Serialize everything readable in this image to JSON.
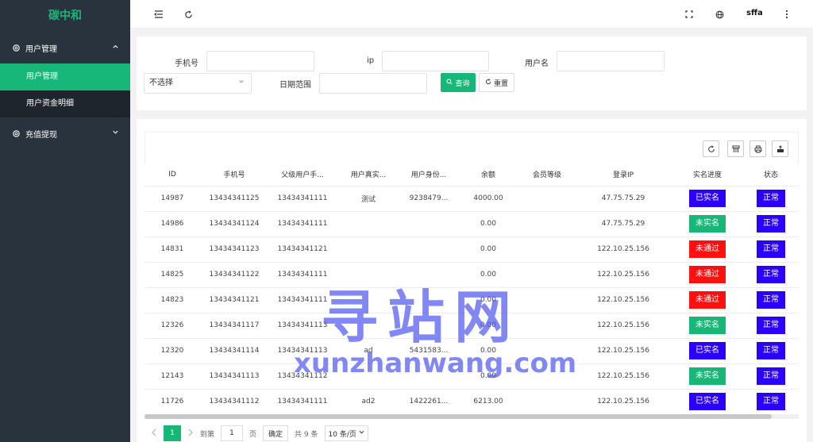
{
  "sidebar": {
    "logo": "碳中和",
    "groups": [
      {
        "label": "用户管理",
        "items": [
          {
            "label": "用户管理"
          },
          {
            "label": "用户资金明细"
          }
        ]
      },
      {
        "label": "充值提现"
      }
    ]
  },
  "topbar": {
    "username": "sffa"
  },
  "search": {
    "phone_label": "手机号",
    "ip_label": "ip",
    "username_label": "用户名",
    "select_value": "不选择",
    "date_label": "日期范围",
    "query_label": "查询",
    "reset_label": "重置"
  },
  "table": {
    "columns": [
      "ID",
      "手机号",
      "父级用户手...",
      "用户真实...",
      "用户身份...",
      "余额",
      "会员等级",
      "登录IP",
      "实名进度",
      "状态"
    ],
    "rows": [
      {
        "id": "14987",
        "phone": "13434341125",
        "parent": "13434341111",
        "realname": "测试",
        "idcard": "9238479...",
        "balance": "4000.00",
        "level": "",
        "ip": "47.75.75.29",
        "verify": "已实名",
        "status": "正常"
      },
      {
        "id": "14986",
        "phone": "13434341124",
        "parent": "13434341111",
        "realname": "",
        "idcard": "",
        "balance": "0.00",
        "level": "",
        "ip": "47.75.75.29",
        "verify": "未实名",
        "status": "正常"
      },
      {
        "id": "14831",
        "phone": "13434341123",
        "parent": "13434341121",
        "realname": "",
        "idcard": "",
        "balance": "0.00",
        "level": "",
        "ip": "122.10.25.156",
        "verify": "未通过",
        "status": "正常"
      },
      {
        "id": "14825",
        "phone": "13434341122",
        "parent": "13434341111",
        "realname": "",
        "idcard": "",
        "balance": "0.00",
        "level": "",
        "ip": "122.10.25.156",
        "verify": "未通过",
        "status": "正常"
      },
      {
        "id": "14823",
        "phone": "13434341121",
        "parent": "13434341111",
        "realname": "",
        "idcard": "",
        "balance": "0.00",
        "level": "",
        "ip": "122.10.25.156",
        "verify": "未通过",
        "status": "正常"
      },
      {
        "id": "12326",
        "phone": "13434341117",
        "parent": "13434341113",
        "realname": "",
        "idcard": "",
        "balance": "0.00",
        "level": "",
        "ip": "122.10.25.156",
        "verify": "未实名",
        "status": "正常"
      },
      {
        "id": "12320",
        "phone": "13434341114",
        "parent": "13434341113",
        "realname": "ad",
        "idcard": "5431583...",
        "balance": "0.00",
        "level": "",
        "ip": "122.10.25.156",
        "verify": "已实名",
        "status": "正常"
      },
      {
        "id": "12143",
        "phone": "13434341113",
        "parent": "13434341112",
        "realname": "",
        "idcard": "",
        "balance": "0.00",
        "level": "",
        "ip": "122.10.25.156",
        "verify": "未实名",
        "status": "正常"
      },
      {
        "id": "11726",
        "phone": "13434341112",
        "parent": "13434341111",
        "realname": "ad2",
        "idcard": "1422261...",
        "balance": "6213.00",
        "level": "",
        "ip": "122.10.25.156",
        "verify": "已实名",
        "status": "正常"
      }
    ]
  },
  "pager": {
    "current": "1",
    "goto_label": "到第",
    "goto_value": "1",
    "page_unit": "页",
    "confirm_label": "确定",
    "total_label": "共 9 条",
    "page_size": "10 条/页"
  },
  "watermark": {
    "cn": "寻站网",
    "en": "xunzhanwang.com"
  },
  "colors": {
    "brand": "#16b777",
    "sidebar_bg": "#28333e",
    "verified": "#2b00ff",
    "unverified": "#16b777",
    "rejected": "#ff1010",
    "status_normal": "#2b00ff"
  }
}
